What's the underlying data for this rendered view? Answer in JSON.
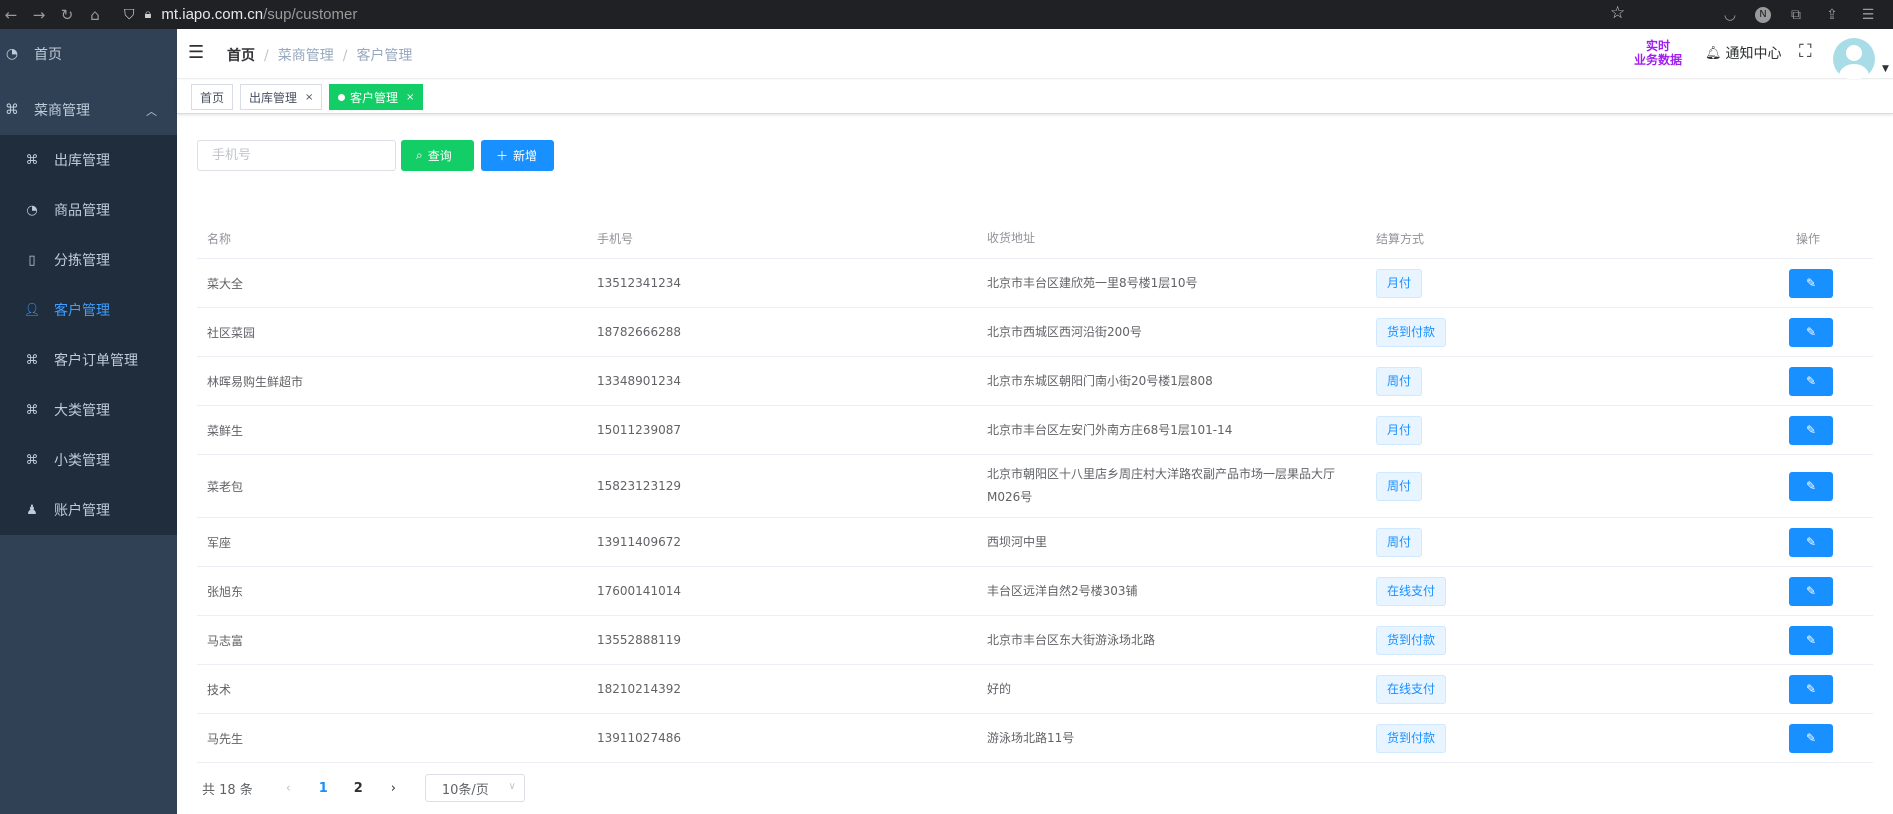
{
  "browser": {
    "url_host": "mt.iapo.com.cn",
    "url_path": "/sup/customer"
  },
  "sidebar": {
    "home": "首页",
    "group": "菜商管理",
    "items": [
      {
        "label": "出库管理",
        "icon": "apps-icon"
      },
      {
        "label": "商品管理",
        "icon": "dashboard-icon"
      },
      {
        "label": "分拣管理",
        "icon": "document-icon"
      },
      {
        "label": "客户管理",
        "icon": "user-icon",
        "active": true
      },
      {
        "label": "客户订单管理",
        "icon": "apps-icon"
      },
      {
        "label": "大类管理",
        "icon": "apps-icon"
      },
      {
        "label": "小类管理",
        "icon": "apps-icon"
      },
      {
        "label": "账户管理",
        "icon": "account-icon"
      }
    ]
  },
  "header": {
    "breadcrumb": [
      "首页",
      "菜商管理",
      "客户管理"
    ],
    "realtime_line1": "实时",
    "realtime_line2": "业务数据",
    "notify": "通知中心"
  },
  "tags": [
    "首页",
    "出库管理",
    "客户管理"
  ],
  "toolbar": {
    "phone_placeholder": "手机号",
    "search_label": "查询",
    "add_label": "新增"
  },
  "table": {
    "headers": [
      "名称",
      "手机号",
      "收货地址",
      "结算方式",
      "操作"
    ],
    "rows": [
      {
        "name": "菜大全",
        "phone": "13512341234",
        "address": "北京市丰台区建欣苑一里8号楼1层10号",
        "pay": "月付"
      },
      {
        "name": "社区菜园",
        "phone": "18782666288",
        "address": "北京市西城区西河沿街200号",
        "pay": "货到付款"
      },
      {
        "name": "林晖易购生鲜超市",
        "phone": "13348901234",
        "address": "北京市东城区朝阳门南小街20号楼1层808",
        "pay": "周付"
      },
      {
        "name": "菜鲜生",
        "phone": "15011239087",
        "address": "北京市丰台区左安门外南方庄68号1层101-14",
        "pay": "月付"
      },
      {
        "name": "菜老包",
        "phone": "15823123129",
        "address": "北京市朝阳区十八里店乡周庄村大洋路农副产品市场一层果品大厅M026号",
        "pay": "周付"
      },
      {
        "name": "军座",
        "phone": "13911409672",
        "address": "西坝河中里",
        "pay": "周付"
      },
      {
        "name": "张旭东",
        "phone": "17600141014",
        "address": "丰台区远洋自然2号楼303铺",
        "pay": "在线支付"
      },
      {
        "name": "马志富",
        "phone": "13552888119",
        "address": "北京市丰台区东大街游泳场北路",
        "pay": "货到付款"
      },
      {
        "name": "技术",
        "phone": "18210214392",
        "address": "好的",
        "pay": "在线支付"
      },
      {
        "name": "马先生",
        "phone": "13911027486",
        "address": "游泳场北路11号",
        "pay": "货到付款"
      }
    ]
  },
  "pagination": {
    "total": "共 18 条",
    "pages": [
      "1",
      "2"
    ],
    "current": "1",
    "page_size": "10条/页"
  }
}
